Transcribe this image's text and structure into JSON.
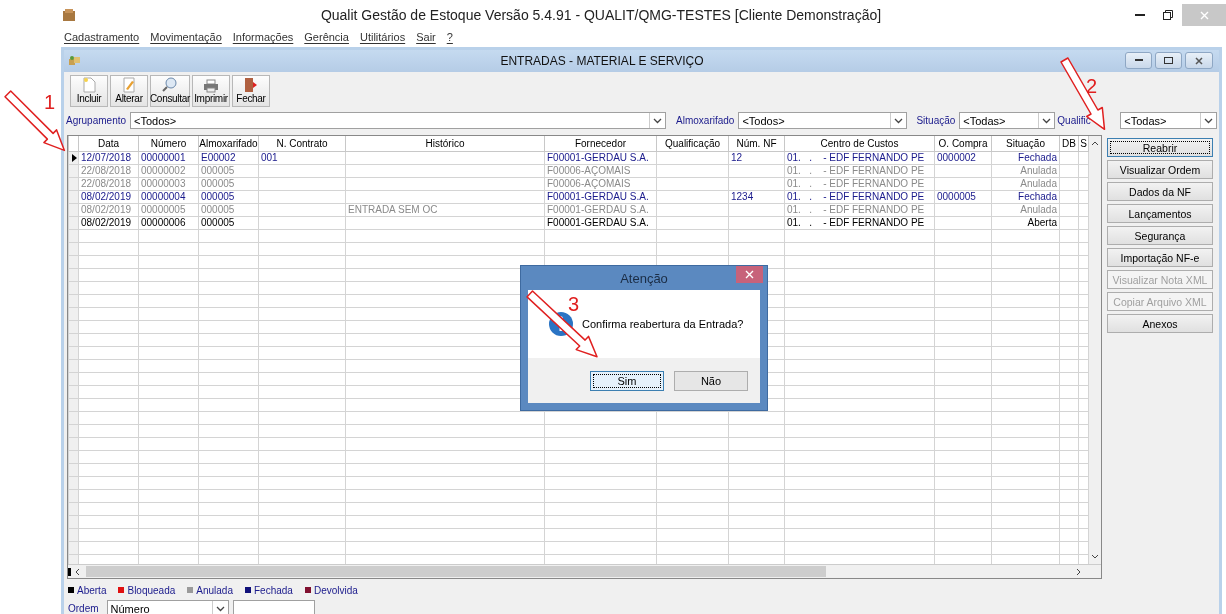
{
  "app_window": {
    "title": "Qualit Gestão de Estoque Versão 5.4.91 - QUALIT/QMG-TESTES [Cliente Demonstração]"
  },
  "menu": [
    "Cadastramento",
    "Movimentação",
    "Informações",
    "Gerência",
    "Utilitários",
    "Sair",
    "?"
  ],
  "child_window": {
    "title": "ENTRADAS - MATERIAL E SERVIÇO"
  },
  "toolbar": [
    "Incluir",
    "Alterar",
    "Consultar",
    "Imprimir",
    "Fechar"
  ],
  "filters": [
    {
      "label": "Agrupamento",
      "value": "<Todos>"
    },
    {
      "label": "Almoxarifado",
      "value": "<Todos>"
    },
    {
      "label": "Situação",
      "value": "<Todas>"
    },
    {
      "label": "Qualific",
      "value": "<Todas>"
    }
  ],
  "table": {
    "columns": [
      "Data",
      "Número",
      "Almoxarifado",
      "N. Contrato",
      "Histórico",
      "Fornecedor",
      "Qualificação",
      "Núm. NF",
      "Centro de Custos",
      "O. Compra",
      "Situação",
      "DB",
      "S"
    ],
    "rows": [
      {
        "selected": true,
        "kind": "closed",
        "cells": [
          "12/07/2018",
          "00000001",
          "E00002",
          "001",
          "",
          "F00001-GERDAU S.A.",
          "",
          "12",
          "01.   .    - EDF FERNANDO PE",
          "0000002",
          "Fechada",
          "",
          ""
        ]
      },
      {
        "selected": false,
        "kind": "void",
        "cells": [
          "22/08/2018",
          "00000002",
          "000005",
          "",
          "",
          "F00006-AÇOMAIS",
          "",
          "",
          "01.   .    - EDF FERNANDO PE",
          "",
          "Anulada",
          "",
          ""
        ]
      },
      {
        "selected": false,
        "kind": "void",
        "cells": [
          "22/08/2018",
          "00000003",
          "000005",
          "",
          "",
          "F00006-AÇOMAIS",
          "",
          "",
          "01.   .    - EDF FERNANDO PE",
          "",
          "Anulada",
          "",
          ""
        ]
      },
      {
        "selected": false,
        "kind": "closed",
        "cells": [
          "08/02/2019",
          "00000004",
          "000005",
          "",
          "",
          "F00001-GERDAU S.A.",
          "",
          "1234",
          "01.   .    - EDF FERNANDO PE",
          "0000005",
          "Fechada",
          "",
          ""
        ]
      },
      {
        "selected": false,
        "kind": "void",
        "cells": [
          "08/02/2019",
          "00000005",
          "000005",
          "",
          "ENTRADA SEM OC",
          "F00001-GERDAU S.A.",
          "",
          "",
          "01.   .    - EDF FERNANDO PE",
          "",
          "Anulada",
          "",
          ""
        ]
      },
      {
        "selected": false,
        "kind": "open",
        "cells": [
          "08/02/2019",
          "00000006",
          "000005",
          "",
          "",
          "F00001-GERDAU S.A.",
          "",
          "",
          "01.   .    - EDF FERNANDO PE",
          "",
          "Aberta",
          "",
          ""
        ]
      }
    ]
  },
  "actions": [
    {
      "label": "Reabrir",
      "disabled": false,
      "focused": true
    },
    {
      "label": "Visualizar Ordem",
      "disabled": false,
      "focused": false
    },
    {
      "label": "Dados da NF",
      "disabled": false,
      "focused": false
    },
    {
      "label": "Lançamentos",
      "disabled": false,
      "focused": false
    },
    {
      "label": "Segurança",
      "disabled": false,
      "focused": false
    },
    {
      "label": "Importação NF-e",
      "disabled": false,
      "focused": false
    },
    {
      "label": "Visualizar Nota XML",
      "disabled": true,
      "focused": false
    },
    {
      "label": "Copiar Arquivo XML",
      "disabled": true,
      "focused": false
    },
    {
      "label": "Anexos",
      "disabled": false,
      "focused": false
    }
  ],
  "legend": [
    {
      "label": "Aberta",
      "color": "#000000"
    },
    {
      "label": "Bloqueada",
      "color": "#e01010"
    },
    {
      "label": "Anulada",
      "color": "#9a9a9a"
    },
    {
      "label": "Fechada",
      "color": "#10107a"
    },
    {
      "label": "Devolvida",
      "color": "#801030"
    }
  ],
  "order": {
    "label": "Ordem",
    "value": "Número"
  },
  "dialog": {
    "title": "Atenção",
    "message": "Confirma reabertura da Entrada?",
    "buttons": [
      {
        "label": "Sim",
        "focused": true
      },
      {
        "label": "Não",
        "focused": false
      }
    ]
  },
  "annotations": [
    "1",
    "2",
    "3"
  ]
}
